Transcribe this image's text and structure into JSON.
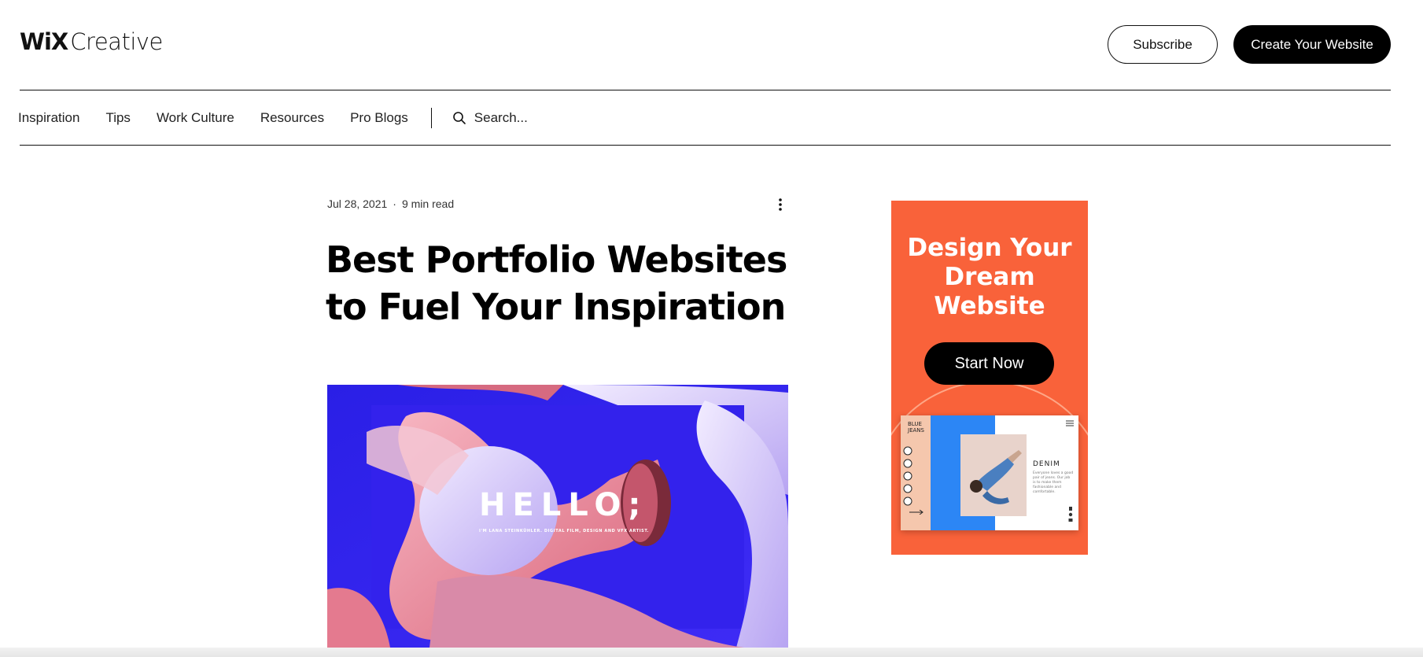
{
  "header": {
    "logo_wix": "WiX",
    "logo_creative": "Creative",
    "subscribe_label": "Subscribe",
    "create_label": "Create Your Website"
  },
  "nav": {
    "items": [
      {
        "label": "Inspiration"
      },
      {
        "label": "Tips"
      },
      {
        "label": "Work Culture"
      },
      {
        "label": "Resources"
      },
      {
        "label": "Pro Blogs"
      }
    ],
    "search_placeholder": "Search..."
  },
  "article": {
    "date": "Jul 28, 2021",
    "separator": "·",
    "read_time": "9 min read",
    "title_line1": "Best Portfolio Websites",
    "title_line2": "to Fuel Your Inspiration",
    "hero": {
      "headline": "HELLO;",
      "tagline": "I'M LANA STEINKÜHLER. DIGITAL FILM, DESIGN AND VFX ARTIST."
    }
  },
  "ad": {
    "title_line1": "Design Your",
    "title_line2": "Dream",
    "title_line3": "Website",
    "button_label": "Start Now",
    "mockup": {
      "brand_line1": "BLUE",
      "brand_line2": "JEANS",
      "heading": "DENIM",
      "body": "Everyone loves a good pair of jeans. Our job is to make them fashionable and comfortable."
    }
  },
  "colors": {
    "ad_background": "#f9623a",
    "hero_blue": "#3a1ff0",
    "button_black": "#000000"
  }
}
